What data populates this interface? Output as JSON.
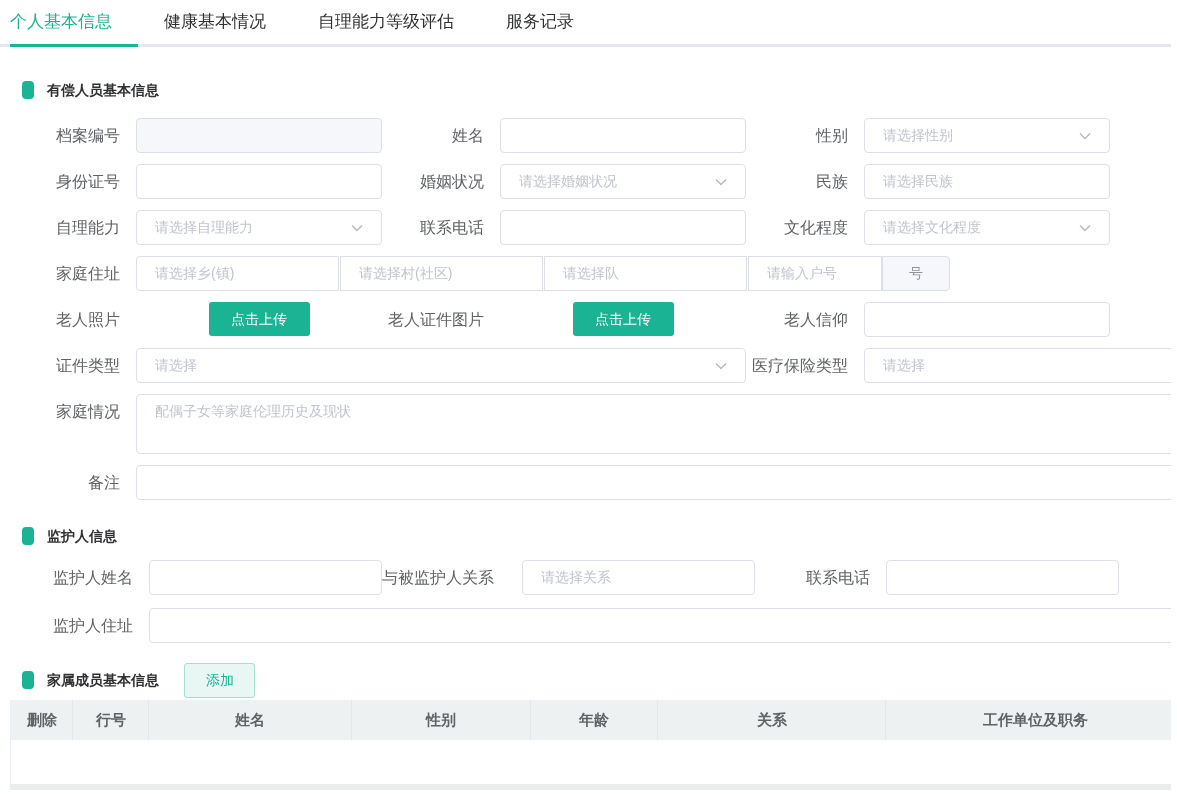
{
  "tabs": [
    {
      "label": "个人基本信息",
      "selected": true
    },
    {
      "label": "健康基本情况",
      "selected": false
    },
    {
      "label": "自理能力等级评估",
      "selected": false
    },
    {
      "label": "服务记录",
      "selected": false
    }
  ],
  "basic_info": {
    "title": "有偿人员基本信息",
    "rows": [
      [
        {
          "label": "档案编号",
          "kind": "readonly"
        },
        {
          "label": "姓名",
          "kind": "input"
        },
        {
          "label": "性别",
          "kind": "select",
          "placeholder": "请选择性别"
        }
      ],
      [
        {
          "label": "身份证号",
          "kind": "input"
        },
        {
          "label": "婚姻状况",
          "kind": "select",
          "placeholder": "请选择婚姻状况"
        },
        {
          "label": "民族",
          "kind": "input",
          "placeholder": "请选择民族"
        }
      ],
      [
        {
          "label": "自理能力",
          "kind": "select",
          "placeholder": "请选择自理能力"
        },
        {
          "label": "联系电话",
          "kind": "input"
        },
        {
          "label": "文化程度",
          "kind": "select",
          "placeholder": "请选择文化程度"
        }
      ],
      [
        {
          "label": "家庭住址",
          "kind": "address",
          "parts": [
            "请选择乡(镇)",
            "请选择村(社区)",
            "请选择队",
            "请输入户号"
          ],
          "suffix": "号"
        }
      ],
      [
        {
          "label": "老人照片",
          "kind": "upload",
          "button": "点击上传"
        },
        {
          "label": "老人证件图片",
          "kind": "upload",
          "button": "点击上传"
        },
        {
          "label": "老人信仰",
          "kind": "input"
        }
      ],
      [
        {
          "label": "证件类型",
          "kind": "select",
          "placeholder": "请选择"
        },
        "",
        {
          "label": "医疗保险类型",
          "kind": "input",
          "placeholder": "请选择"
        }
      ],
      [
        {
          "label": "家庭情况",
          "kind": "textarea",
          "placeholder": "配偶子女等家庭伦理历史及现状"
        }
      ],
      [
        {
          "label": "备注",
          "kind": "input"
        }
      ]
    ]
  },
  "guardian": {
    "title": "监护人信息",
    "rows": [
      [
        {
          "label": "监护人姓名",
          "kind": "input"
        },
        {
          "label": "与被监护人关系",
          "kind": "input",
          "placeholder": "请选择关系"
        },
        {
          "label": "联系电话",
          "kind": "input"
        }
      ],
      [
        {
          "label": "监护人住址",
          "kind": "input"
        }
      ]
    ]
  },
  "family": {
    "title": "家属成员基本信息",
    "add_button": "添加",
    "columns": [
      "删除",
      "行号",
      "姓名",
      "性别",
      "年龄",
      "关系",
      "工作单位及职务"
    ]
  }
}
